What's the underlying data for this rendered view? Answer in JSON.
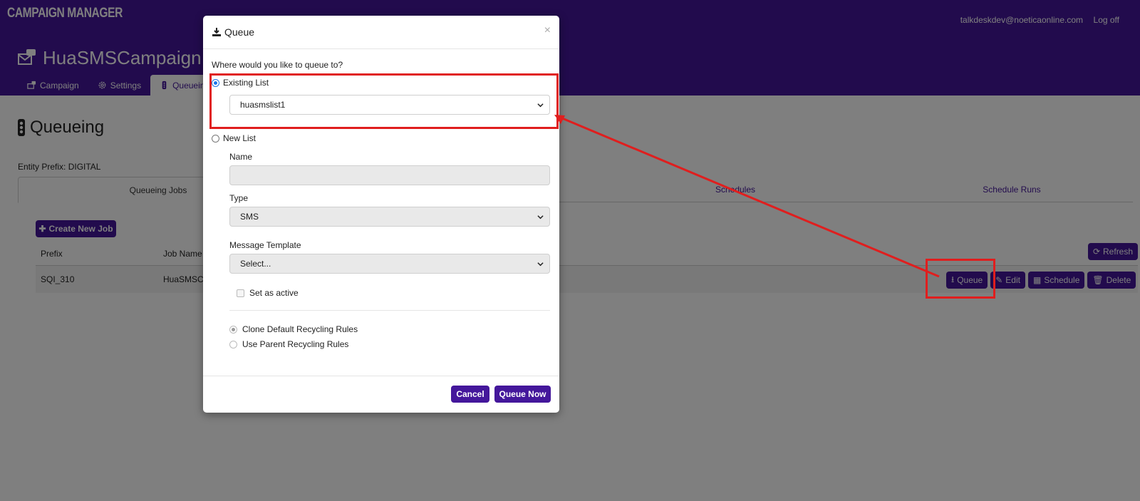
{
  "app": {
    "brand": "CAMPAIGN MANAGER",
    "user_email": "talkdeskdev@noeticaonline.com",
    "logoff_label": "Log off"
  },
  "campaign": {
    "title": "HuaSMSCampaign"
  },
  "tabs": [
    {
      "label": "Campaign",
      "icon": "campaign-icon"
    },
    {
      "label": "Settings",
      "icon": "gear-icon"
    },
    {
      "label": "Queueing",
      "icon": "traffic-light-icon",
      "active": true
    }
  ],
  "page": {
    "title": "Queueing",
    "entity_prefix": "Entity Prefix: DIGITAL",
    "subtabs": [
      "Queueing Jobs",
      "Schedules",
      "Schedule Runs"
    ],
    "create_button": "Create New Job",
    "refresh_button": "Refresh",
    "table": {
      "headers": [
        "Prefix",
        "Job Name"
      ],
      "rows": [
        {
          "prefix": "SQI_310",
          "job_name": "HuaSMSCa"
        }
      ],
      "row_actions": [
        "Queue",
        "Edit",
        "Schedule",
        "Delete"
      ]
    }
  },
  "modal": {
    "title": "Queue",
    "close_symbol": "×",
    "question": "Where would you like to queue to?",
    "existing_list_label": "Existing List",
    "existing_list_value": "huasmslist1",
    "new_list_label": "New List",
    "name_label": "Name",
    "name_value": "",
    "type_label": "Type",
    "type_value": "SMS",
    "template_label": "Message Template",
    "template_value": "Select...",
    "set_active_label": "Set as active",
    "clone_rules_label": "Clone Default Recycling Rules",
    "parent_rules_label": "Use Parent Recycling Rules",
    "cancel_button": "Cancel",
    "queue_now_button": "Queue Now"
  },
  "colors": {
    "primary": "#44179b",
    "annotation": "#e01e1e",
    "radio": "#1a73e8"
  }
}
